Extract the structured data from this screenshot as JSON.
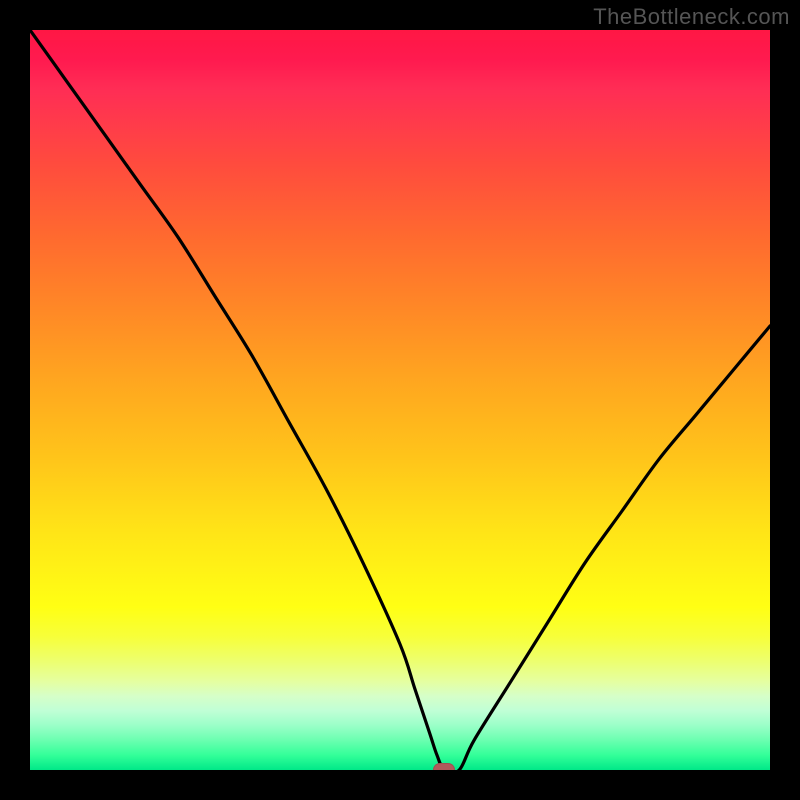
{
  "attribution": "TheBottleneck.com",
  "chart_data": {
    "type": "line",
    "title": "",
    "xlabel": "",
    "ylabel": "",
    "xlim": [
      0,
      100
    ],
    "ylim": [
      0,
      100
    ],
    "series": [
      {
        "name": "bottleneck-curve",
        "x": [
          0,
          5,
          10,
          15,
          20,
          25,
          30,
          35,
          40,
          45,
          50,
          52,
          54,
          55,
          56,
          58,
          60,
          65,
          70,
          75,
          80,
          85,
          90,
          95,
          100
        ],
        "values": [
          100,
          93,
          86,
          79,
          72,
          64,
          56,
          47,
          38,
          28,
          17,
          11,
          5,
          2,
          0,
          0,
          4,
          12,
          20,
          28,
          35,
          42,
          48,
          54,
          60
        ]
      }
    ],
    "marker": {
      "x": 56,
      "y": 0
    },
    "background": "red-yellow-green-vertical-gradient"
  },
  "colors": {
    "curve": "#000000",
    "marker": "#b15b5b",
    "frame": "#000000"
  }
}
